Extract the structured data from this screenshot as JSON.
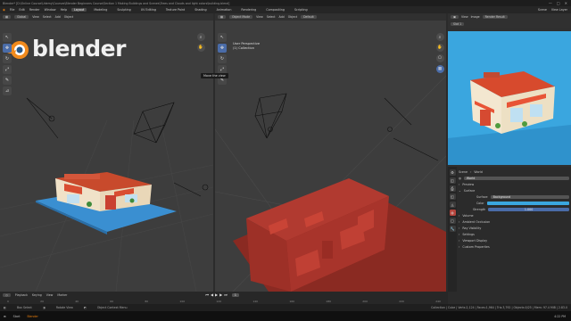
{
  "window": {
    "title": "Blender* [D:\\Online Course\\Udemy\\Courses\\Blender Beginners Course\\Section 1 Making Buildings and Scenes\\Trees and Clouds and light colors\\building.blend]",
    "controls": [
      "—",
      "□",
      "✕"
    ]
  },
  "menubar": {
    "items": [
      "File",
      "Edit",
      "Render",
      "Window",
      "Help"
    ],
    "workspaces": [
      "Layout",
      "Modeling",
      "Sculpting",
      "UV Editing",
      "Texture Paint",
      "Shading",
      "Animation",
      "Rendering",
      "Compositing",
      "Scripting"
    ],
    "active_workspace": "Layout",
    "scene": "Scene",
    "view_layer": "View Layer"
  },
  "left_viewport": {
    "mode": "Object Mode",
    "menus": [
      "View",
      "Select",
      "Add",
      "Object"
    ],
    "orientation": "Global",
    "logo_text": "blender"
  },
  "mid_viewport": {
    "mode": "Object Mode",
    "menus": [
      "View",
      "Select",
      "Add",
      "Object"
    ],
    "orientation": "Default",
    "perspective_label": "User Perspective",
    "collection_label": "(1) Collection",
    "tooltip": "Move the view"
  },
  "render_view": {
    "header": [
      "View",
      "Image"
    ],
    "image_name": "Render Result",
    "slot": "Slot 1",
    "sky_color": "#3aa6df"
  },
  "properties": {
    "scene_label": "Scene",
    "world_label": "World",
    "world_name": "World",
    "sections": [
      "Preview",
      "Surface"
    ],
    "surface_label": "Surface",
    "surface_value": "Background",
    "color_label": "Color",
    "strength_label": "Strength",
    "strength_value": "1.000",
    "subsections": [
      "Volume",
      "Ambient Occlusion",
      "Ray Visibility",
      "Settings",
      "Viewport Display",
      "Custom Properties"
    ]
  },
  "timeline": {
    "menus": [
      "Playback",
      "Keying",
      "View",
      "Marker"
    ],
    "ruler": [
      "0",
      "20",
      "40",
      "60",
      "80",
      "100",
      "120",
      "140",
      "160",
      "180",
      "200",
      "220",
      "240"
    ],
    "frame_label": "1"
  },
  "statusbar": {
    "items": [
      "Box Select",
      "Rotate View",
      "Object Context Menu"
    ],
    "version": "Collection | Cube | Verts:2,124 | Faces:1,964 | Tris:3,792 | Objects:0/25 | Mem: 97.4 MiB | 2.83.0"
  },
  "taskbar": {
    "items": [
      "Start",
      "Blender"
    ],
    "clock": "4:22 PM"
  }
}
